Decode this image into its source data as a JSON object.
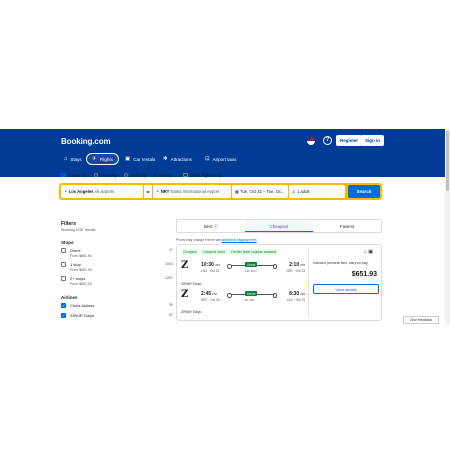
{
  "header": {
    "logo": "Booking.com",
    "register": "Register",
    "signin": "Sign in",
    "help": "?",
    "nav": [
      {
        "label": "Stays",
        "icon": "bed-icon"
      },
      {
        "label": "Flights",
        "icon": "plane-icon"
      },
      {
        "label": "Car rentals",
        "icon": "car-icon"
      },
      {
        "label": "Attractions",
        "icon": "attractions-icon"
      },
      {
        "label": "Airport taxis",
        "icon": "taxi-icon"
      }
    ]
  },
  "trip": {
    "round_trip": "Round trip",
    "one_way": "One way",
    "multi_city": "Multi-city",
    "cabin": "Economy",
    "direct_only": "Direct flights only"
  },
  "search": {
    "from_code": "Los Angeles",
    "from_rest": "All airports",
    "to_code": "NRT",
    "to_rest": "Narita International Airport",
    "dates": "Tue, Oct 22 – Tue, Oc...",
    "travelers": "1 adult",
    "button": "Search"
  },
  "filters": {
    "title": "Filters",
    "showing": "Showing 1257 results",
    "stops_title": "Stops",
    "stops": [
      {
        "label": "Direct",
        "price": "From $651.93",
        "count": "47"
      },
      {
        "label": "1 stop",
        "price": "From $651.93",
        "count": "1093"
      },
      {
        "label": "2+ stops",
        "price": "From $651.93",
        "count": "1257"
      }
    ],
    "airlines_title": "Airlines",
    "airlines": [
      {
        "label": "China Airlines",
        "count": "39"
      },
      {
        "label": "ZIPAIR Tokyo",
        "count": "57"
      }
    ]
  },
  "results": {
    "tabs": [
      "Best",
      "Cheapest",
      "Fastest"
    ],
    "note_prefix": "Prices may change if there are ",
    "note_link": "additional baggage fees",
    "badges": [
      "Cheapest",
      "Cheapest direct",
      "Flexible ticket upgrade available"
    ],
    "legs": [
      {
        "dep": "10:30",
        "dep_ampm": "AM",
        "dep_sub": "LAX · Oct 22",
        "arr": "2:10",
        "arr_ampm": "PM",
        "arr_sub": "NRT · Oct 23",
        "direct": "Direct",
        "dur": "11h 40m"
      },
      {
        "dep": "2:45",
        "dep_ampm": "PM",
        "dep_sub": "NRT · Oct 29",
        "arr": "8:30",
        "arr_ampm": "AM",
        "arr_sub": "LAX · Oct 29",
        "direct": "Direct",
        "dur": "9h 45m"
      }
    ],
    "operator": "ZIPAIR Tokyo",
    "included": "Included: personal item, carry-on bag",
    "price": "$651.93",
    "details": "View details"
  },
  "feedback": "Give feedback"
}
